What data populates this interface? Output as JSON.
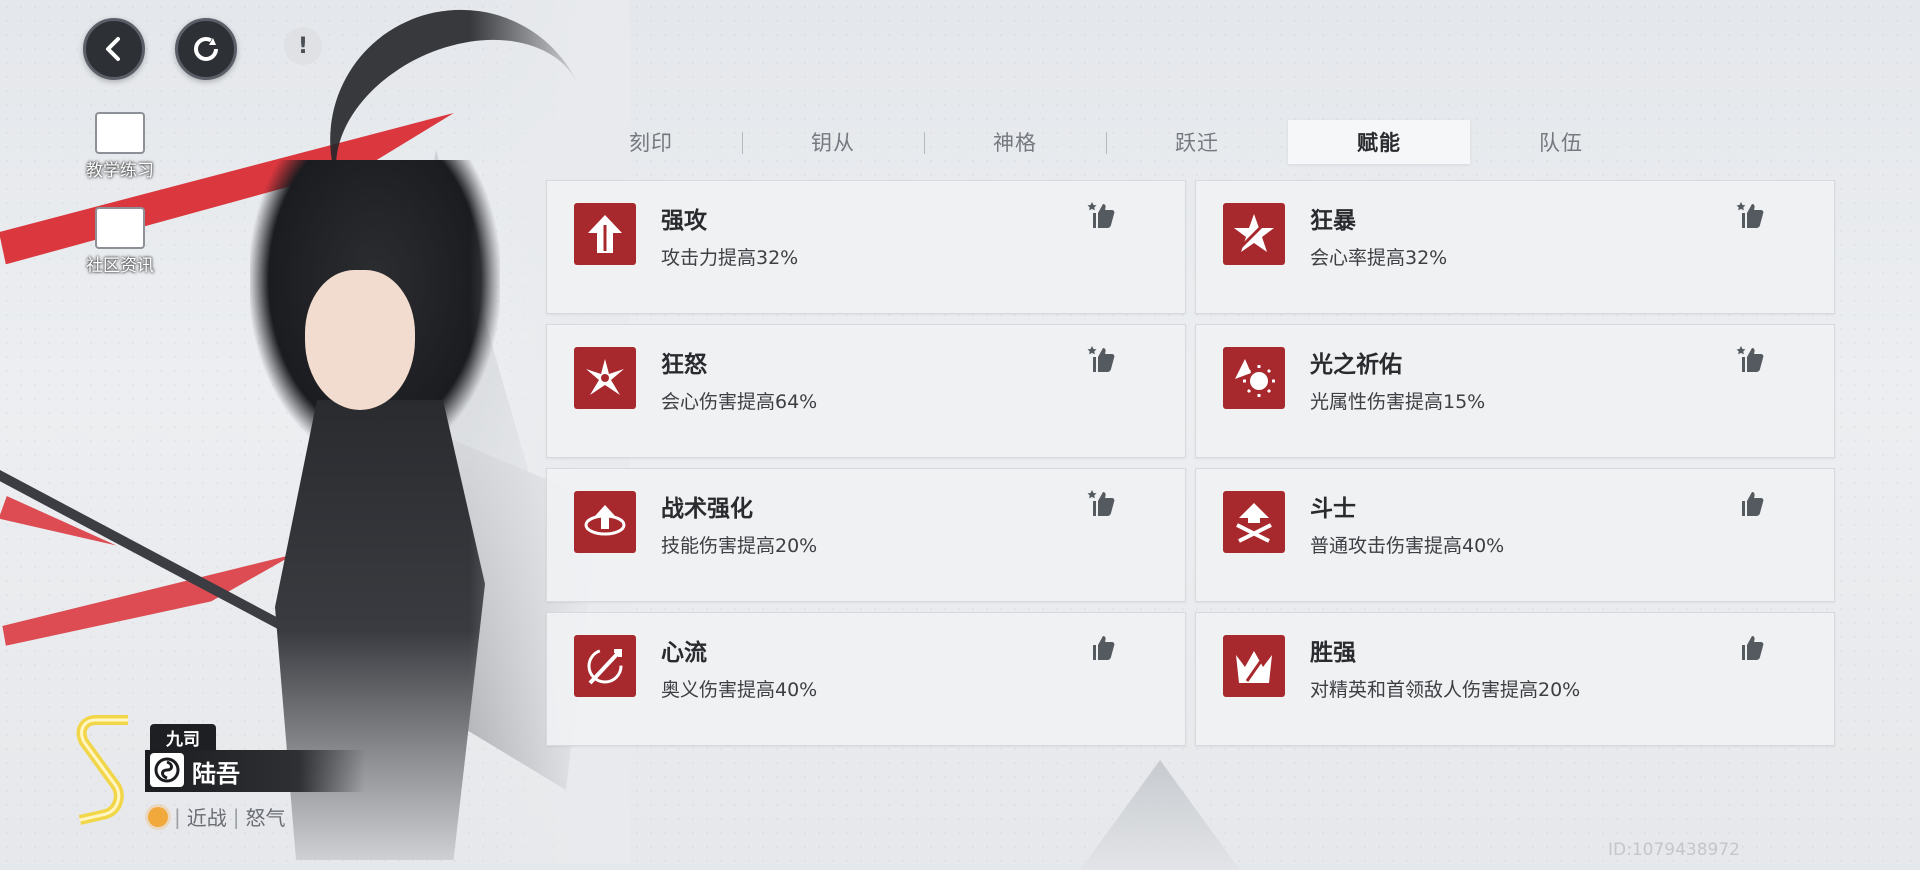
{
  "tabs": [
    "刻印",
    "钥从",
    "神格",
    "跃迁",
    "赋能",
    "队伍"
  ],
  "active_tab": "赋能",
  "side_links": {
    "tutorial": "教学练习",
    "community": "社区资讯"
  },
  "cards": [
    {
      "name": "强攻",
      "desc": "攻击力提高32%",
      "icon": "arrow-up-icon",
      "recommended": true
    },
    {
      "name": "狂暴",
      "desc": "会心率提高32%",
      "icon": "star-burst-icon",
      "recommended": true
    },
    {
      "name": "狂怒",
      "desc": "会心伤害提高64%",
      "icon": "shard-burst-icon",
      "recommended": true
    },
    {
      "name": "光之祈佑",
      "desc": "光属性伤害提高15%",
      "icon": "sun-icon",
      "recommended": true
    },
    {
      "name": "战术强化",
      "desc": "技能伤害提高20%",
      "icon": "orbit-arrow-icon",
      "recommended": true
    },
    {
      "name": "斗士",
      "desc": "普通攻击伤害提高40%",
      "icon": "crossed-swords-icon",
      "recommended": false
    },
    {
      "name": "心流",
      "desc": "奥义伤害提高40%",
      "icon": "spiral-strike-icon",
      "recommended": false
    },
    {
      "name": "胜强",
      "desc": "对精英和首领敌人伤害提高20%",
      "icon": "crown-icon",
      "recommended": false
    }
  ],
  "character": {
    "tag": "九司",
    "name": "陆吾",
    "rank": "S",
    "attrs": [
      "近战",
      "怒气"
    ]
  },
  "uid": "ID:1079438972",
  "colors": {
    "accent": "#a8292d",
    "tab_active_bg": "#f6f7f8",
    "brush_red": "#d8242a",
    "rank_gold": "#f2d64a"
  }
}
